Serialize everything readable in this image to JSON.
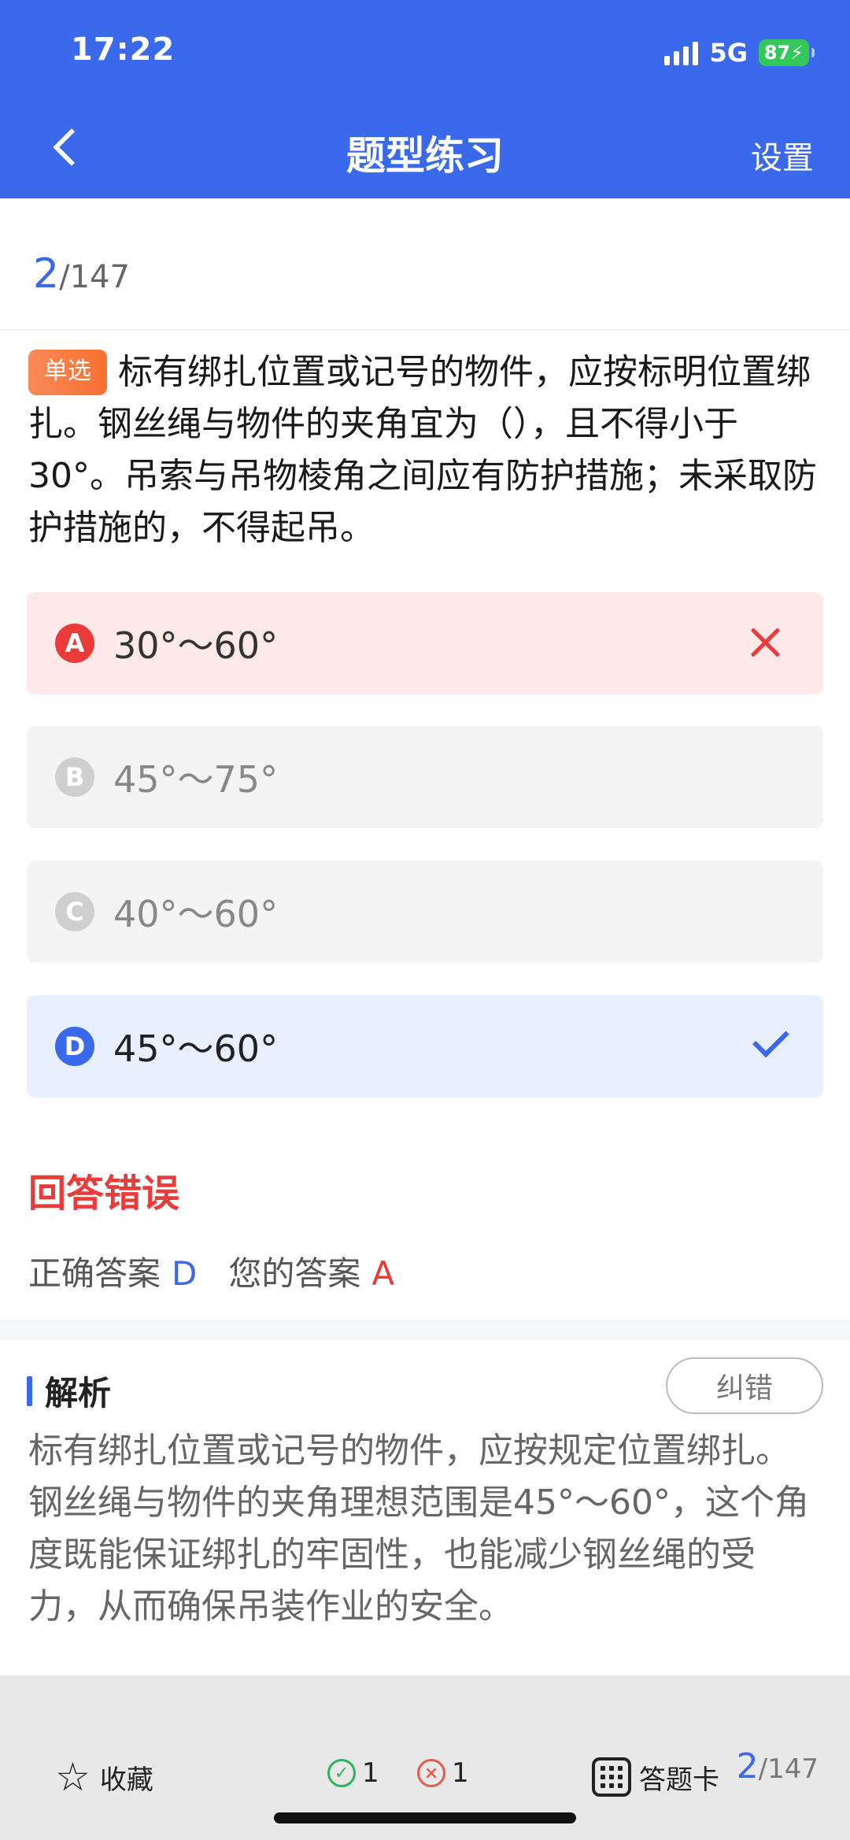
{
  "status": {
    "time": "17:22",
    "network": "5G",
    "battery": "87"
  },
  "header": {
    "title": "题型练习",
    "settings": "设置"
  },
  "counter": {
    "current": "2",
    "total": "/147"
  },
  "question": {
    "tag": "单选",
    "text": "标有绑扎位置或记号的物件，应按标明位置绑扎。钢丝绳与物件的夹角宜为（），且不得小于30°。吊索与吊物棱角之间应有防护措施；未采取防护措施的，不得起吊。"
  },
  "options": [
    {
      "letter": "A",
      "text": "30°～60°",
      "state": "wrong"
    },
    {
      "letter": "B",
      "text": "45°～75°",
      "state": "disabled"
    },
    {
      "letter": "C",
      "text": "40°～60°",
      "state": "disabled"
    },
    {
      "letter": "D",
      "text": "45°～60°",
      "state": "correct"
    }
  ],
  "result": {
    "title": "回答错误",
    "correct_label": "正确答案",
    "correct_value": "D",
    "your_label": "您的答案",
    "your_value": "A"
  },
  "analysis": {
    "title": "解析",
    "report_button": "纠错",
    "text": "标有绑扎位置或记号的物件，应按规定位置绑扎。钢丝绳与物件的夹角理想范围是45°～60°，这个角度既能保证绑扎的牢固性，也能减少钢丝绳的受力，从而确保吊装作业的安全。"
  },
  "bottom_bar": {
    "favorite": "收藏",
    "correct_count": "1",
    "wrong_count": "1",
    "answer_card": "答题卡",
    "current": "2",
    "total": "/147"
  },
  "colors": {
    "primary": "#3b69ec",
    "error": "#ea3b3b",
    "success": "#2bb55a"
  }
}
